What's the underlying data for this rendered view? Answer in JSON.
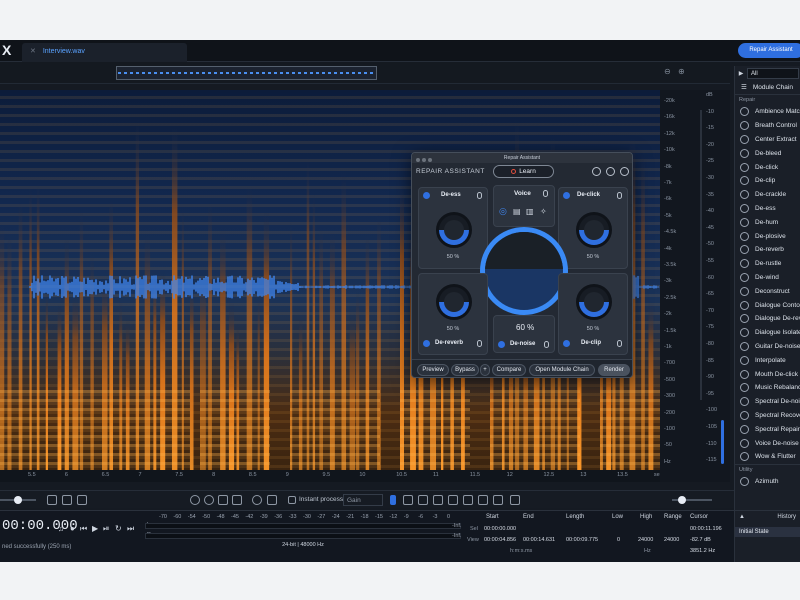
{
  "app": {
    "logo": "X",
    "tab_file": "Interview.wav",
    "repair_assistant_button": "Repair Assistant"
  },
  "ruler": {
    "ticks": [
      "5.5",
      "6",
      "6.5",
      "7",
      "7.5",
      "8",
      "8.5",
      "9",
      "9.5",
      "10",
      "10.5",
      "11",
      "11.5",
      "12",
      "12.5",
      "13",
      "13.5",
      "sec"
    ]
  },
  "axis": {
    "hz_labels": [
      "-20k",
      "-16k",
      "-12k",
      "-10k",
      "-8k",
      "-7k",
      "-6k",
      "-5k",
      "-4.5k",
      "-4k",
      "-3.5k",
      "-3k",
      "-2.5k",
      "-2k",
      "-1.5k",
      "-1k",
      "-700",
      "-500",
      "-300",
      "-200",
      "-100",
      "-50",
      "Hz"
    ],
    "db_labels": [
      "dB",
      "-10",
      "-15",
      "-20",
      "-25",
      "-30",
      "-35",
      "-40",
      "-45",
      "-50",
      "-55",
      "-60",
      "-65",
      "-70",
      "-75",
      "-80",
      "-85",
      "-90",
      "-95",
      "-100",
      "-105",
      "-110",
      "-115"
    ],
    "db_header": "dB",
    "hz_footer": "Hz"
  },
  "sidebar": {
    "filter_value": "All",
    "module_chain": "Module Chain",
    "section_repair": "Repair",
    "repair_items": [
      "Ambience Match",
      "Breath Control",
      "Center Extract",
      "De-bleed",
      "De-click",
      "De-clip",
      "De-crackle",
      "De-ess",
      "De-hum",
      "De-plosive",
      "De-reverb",
      "De-rustle",
      "De-wind",
      "Deconstruct",
      "Dialogue Contour",
      "Dialogue De-reverb",
      "Dialogue Isolate",
      "Guitar De-noise",
      "Interpolate",
      "Mouth De-click",
      "Music Rebalance",
      "Spectral De-noise",
      "Spectral Recovery",
      "Spectral Repair",
      "Voice De-noise",
      "Wow & Flutter"
    ],
    "section_utility": "Utility",
    "utility_items": [
      "Azimuth"
    ]
  },
  "toolbar": {
    "instant_process": "Instant process",
    "gain": "Gain"
  },
  "transport": {
    "time": "00:00.000",
    "status": "ned successfully (250 ms)",
    "meter_l": "L",
    "meter_r": "R",
    "meter_inf_left": "-Inf.",
    "meter_inf_right": "-Inf.",
    "meter_scale": [
      "-70",
      "-60",
      "-54",
      "-50",
      "-48",
      "-45",
      "-42",
      "-39",
      "-36",
      "-33",
      "-30",
      "-27",
      "-24",
      "-21",
      "-18",
      "-15",
      "-12",
      "-9",
      "-6",
      "-3",
      "0"
    ],
    "format": "24-bit | 48000 Hz"
  },
  "selection": {
    "headers": {
      "start": "Start",
      "end": "End",
      "length": "Length",
      "low": "Low",
      "high": "High",
      "range": "Range",
      "cursor": "Cursor"
    },
    "sel_label": "Sel",
    "view_label": "View",
    "sel": {
      "start": "00:00:00.000",
      "end": "",
      "length": ""
    },
    "view": {
      "start": "00:00:04.856",
      "end": "00:00:14.631",
      "length": "00:00:09.775",
      "low": "0",
      "high": "24000",
      "range": "24000"
    },
    "cursor_time": "00:00:11.196",
    "cursor_db": "-82.7 dB",
    "cursor_hz": "3851.2 Hz",
    "format_time": "h:m:s.ms",
    "format_hz": "Hz"
  },
  "history": {
    "title": "History",
    "items": [
      "Initial State"
    ]
  },
  "repair_assistant": {
    "title": "Repair Assistant",
    "header": "REPAIR ASSISTANT",
    "learn": "Learn",
    "modules": {
      "deess": {
        "name": "De-ess",
        "pct": "50 %"
      },
      "voice": {
        "name": "Voice"
      },
      "declick": {
        "name": "De-click",
        "pct": "50 %"
      },
      "dereverb": {
        "name": "De-reverb",
        "pct": "50 %"
      },
      "denoise": {
        "name": "De-noise",
        "pct": "60 %"
      },
      "declip": {
        "name": "De-clip",
        "pct": "50 %"
      }
    },
    "buttons": {
      "preview": "Preview",
      "bypass": "Bypass",
      "plus": "+",
      "compare": "Compare",
      "open_chain": "Open Module Chain",
      "render": "Render"
    }
  },
  "colors": {
    "accent": "#2f6fe0",
    "spectro_warm": "#f08a1e",
    "spectro_cool": "#13295a",
    "waveform": "#3f86f0"
  }
}
